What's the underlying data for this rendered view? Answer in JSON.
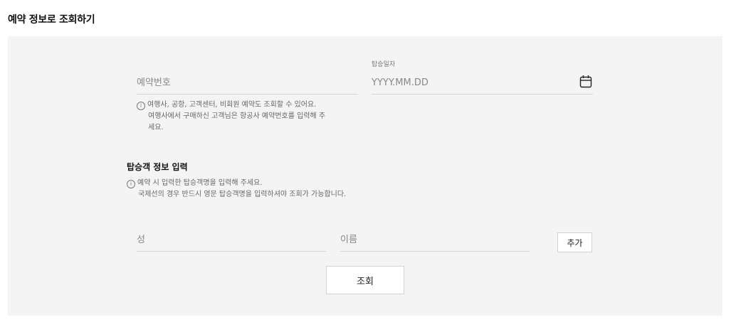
{
  "page": {
    "title": "예약 정보로 조회하기"
  },
  "reservation": {
    "number_placeholder": "예약번호",
    "hint_lines": [
      "여행사, 공항, 고객센터, 비회원 예약도 조회할 수 있어요.",
      "여행사에서 구매하신 고객님은 항공사 예약번호를 입력해 주",
      "세요."
    ],
    "date_label": "탑승일자",
    "date_placeholder": "YYYY.MM.DD",
    "date_icon": "calendar-icon"
  },
  "passenger": {
    "section_title": "탑승객 정보 입력",
    "hint_lines": [
      "예약 시 입력한 탑승객명을 입력해 주세요.",
      "국제선의 경우 반드시 영문 탑승객명을 입력하셔야 조회가 가능합니다."
    ],
    "last_name_placeholder": "성",
    "first_name_placeholder": "이름",
    "add_label": "추가"
  },
  "actions": {
    "search_label": "조회"
  },
  "icons": {
    "info": "info-icon"
  },
  "colors": {
    "panel_bg": "#f4f4f4",
    "divider": "#d6d6d6",
    "text": "#222222",
    "muted": "#777777"
  }
}
